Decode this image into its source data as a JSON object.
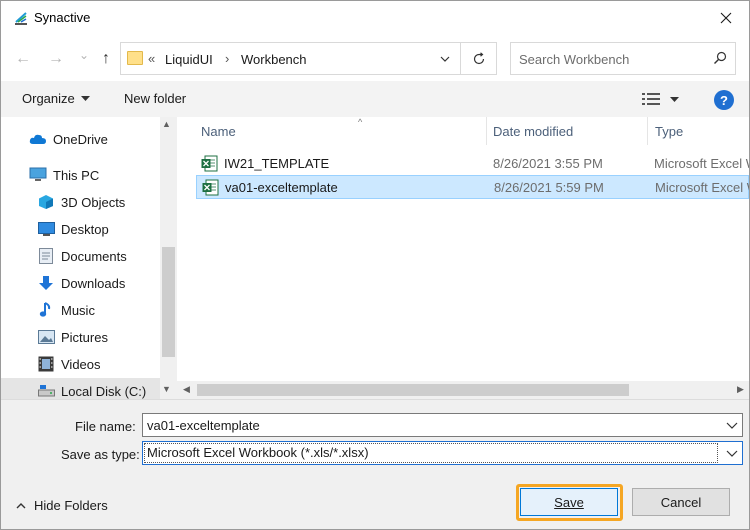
{
  "window": {
    "title": "Synactive"
  },
  "nav": {
    "back": "←",
    "forward": "→",
    "recent": "⌄",
    "up": "↑",
    "breadcrumb_overflow": "«",
    "crumbs": [
      "LiquidUI",
      "Workbench"
    ],
    "crumb_sep": "›"
  },
  "search": {
    "placeholder": "Search Workbench"
  },
  "toolbar": {
    "organize": "Organize",
    "new_folder": "New folder",
    "help": "?"
  },
  "navpane": {
    "items": [
      {
        "label": "OneDrive",
        "icon": "onedrive-icon"
      },
      {
        "label": "This PC",
        "icon": "computer-icon"
      },
      {
        "label": "3D Objects",
        "icon": "3d-objects-icon"
      },
      {
        "label": "Desktop",
        "icon": "desktop-icon"
      },
      {
        "label": "Documents",
        "icon": "documents-icon"
      },
      {
        "label": "Downloads",
        "icon": "downloads-icon"
      },
      {
        "label": "Music",
        "icon": "music-icon"
      },
      {
        "label": "Pictures",
        "icon": "pictures-icon"
      },
      {
        "label": "Videos",
        "icon": "videos-icon"
      },
      {
        "label": "Local Disk (C:)",
        "icon": "disk-icon"
      }
    ]
  },
  "filelist": {
    "columns": {
      "name": "Name",
      "date": "Date modified",
      "type": "Type"
    },
    "rows": [
      {
        "name": "IW21_TEMPLATE",
        "date": "8/26/2021 3:55 PM",
        "type": "Microsoft Excel W"
      },
      {
        "name": "va01-exceltemplate",
        "date": "8/26/2021 5:59 PM",
        "type": "Microsoft Excel W"
      }
    ]
  },
  "form": {
    "file_name_label": "File name:",
    "file_name_value": "va01-exceltemplate",
    "save_type_label": "Save as type:",
    "save_type_value": "Microsoft Excel Workbook (*.xls/*.xlsx)"
  },
  "footer": {
    "hide_folders": "Hide Folders",
    "save": "Save",
    "cancel": "Cancel"
  },
  "colors": {
    "accent": "#0078d7",
    "selection": "#cce8ff",
    "highlight": "#f5a623",
    "excel": "#1d6f42"
  }
}
